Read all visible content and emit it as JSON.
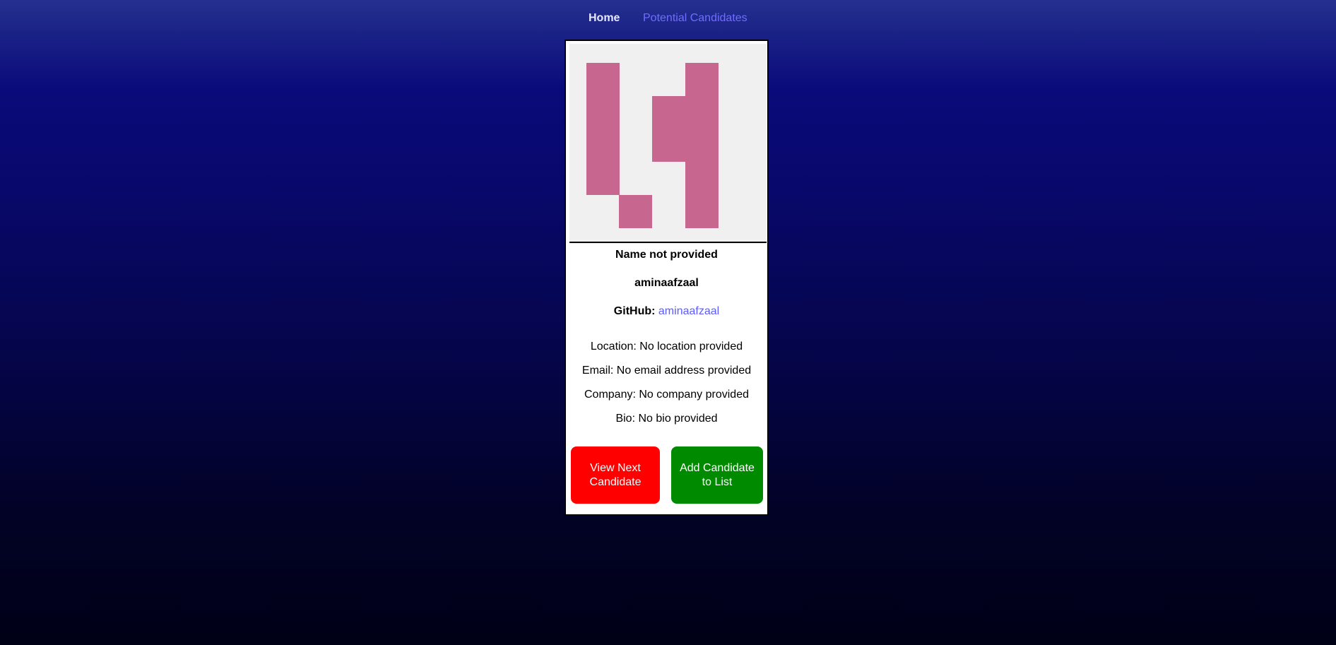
{
  "nav": {
    "home_label": "Home",
    "candidates_label": "Potential Candidates"
  },
  "avatar": {
    "icon": "identicon",
    "color": "#c7668f",
    "background": "#f0f0f0"
  },
  "candidate": {
    "name": "Name not provided",
    "username": "aminaafzaal",
    "github_label": "GitHub:",
    "github_link": "aminaafzaal",
    "location": "Location: No location provided",
    "email": "Email: No email address provided",
    "company": "Company: No company provided",
    "bio": "Bio: No bio provided"
  },
  "actions": {
    "next_label": "View Next Candidate",
    "add_label": "Add Candidate to List",
    "next_color": "#ff0000",
    "add_color": "#008a00"
  },
  "colors": {
    "link": "#6f6dff",
    "nav_active": "#e6e8ff"
  }
}
